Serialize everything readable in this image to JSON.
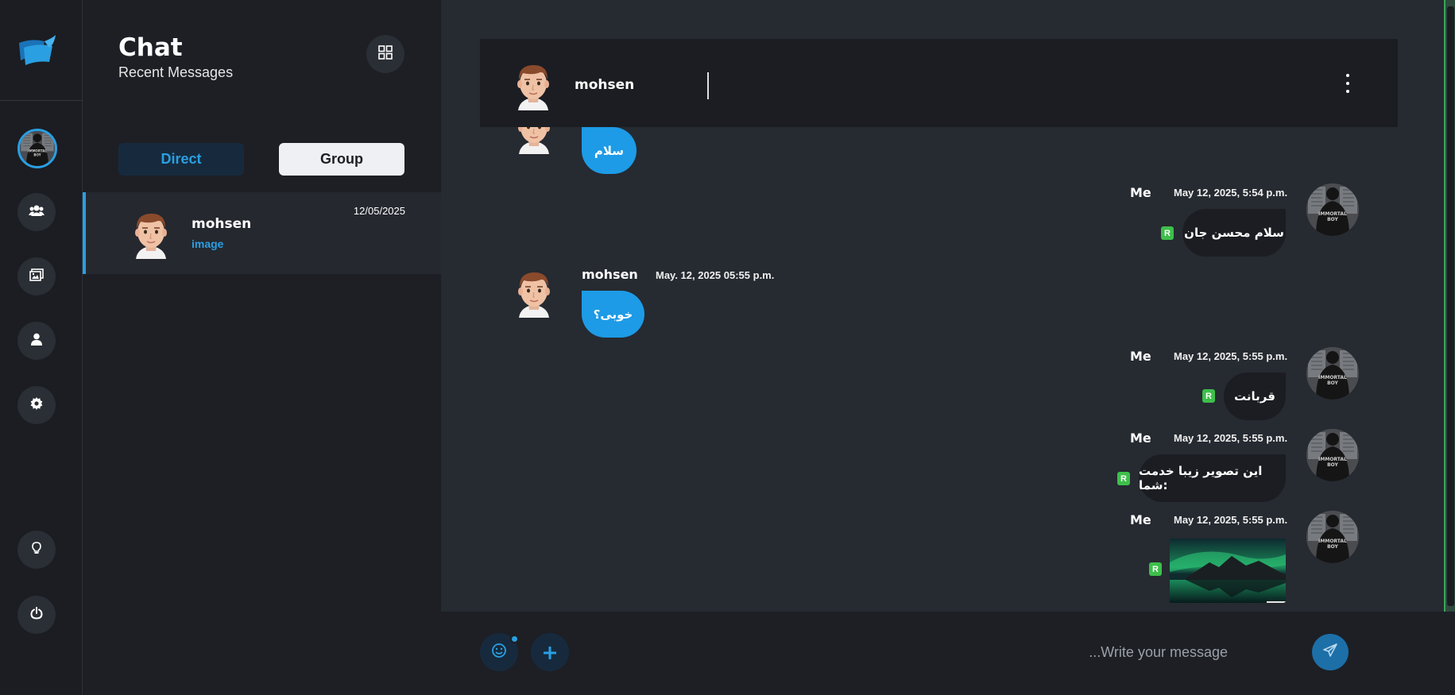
{
  "sidebar": {
    "logo": "app-logo",
    "profile_avatar": "profile-avatar",
    "nav_icons": [
      "users-icon",
      "gallery-icon",
      "user-icon",
      "settings-icon",
      "lightbulb-icon",
      "power-icon"
    ]
  },
  "panel": {
    "title": "Chat",
    "subtitle": "Recent Messages",
    "tabs": {
      "direct": "Direct",
      "group": "Group"
    },
    "conversations": [
      {
        "name": "mohsen",
        "preview": "image",
        "date": "12/05/2025"
      }
    ]
  },
  "chat": {
    "contact_name": "mohsen",
    "messages": [
      {
        "from": "in",
        "text": "سلام"
      },
      {
        "from": "me",
        "sender": "Me",
        "time": "May 12, 2025, 5:54 p.m.",
        "text": "سلام محسن جان",
        "status": "R"
      },
      {
        "from": "in",
        "sender": "mohsen",
        "time": "May. 12, 2025 05:55 p.m.",
        "text": "خوبی؟"
      },
      {
        "from": "me",
        "sender": "Me",
        "time": "May 12, 2025, 5:55 p.m.",
        "text": "قربانت",
        "status": "R"
      },
      {
        "from": "me",
        "sender": "Me",
        "time": "May 12, 2025, 5:55 p.m.",
        "text": "این تصویر زیبا خدمت شما:",
        "status": "R"
      },
      {
        "from": "me",
        "sender": "Me",
        "time": "May 12, 2025, 5:55 p.m.",
        "image": "aurora-mountain-lake",
        "status": "R"
      }
    ]
  },
  "composer": {
    "placeholder": "...Write your message",
    "emoji_icon": "emoji-icon",
    "plus_icon": "plus-icon",
    "send_icon": "send-icon"
  },
  "colors": {
    "accent": "#1d9be6",
    "read_badge": "#3dbf4a",
    "background": "#262a31"
  }
}
